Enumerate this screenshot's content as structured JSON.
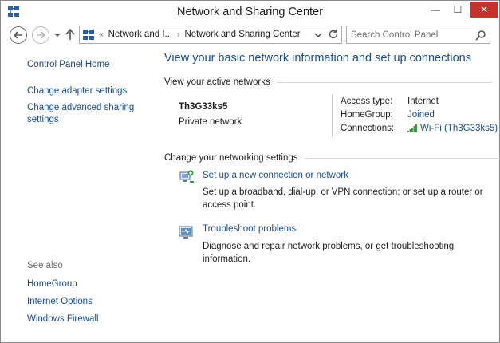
{
  "window": {
    "title": "Network and Sharing Center",
    "controls": {
      "minimize": "—",
      "maximize": "☐",
      "close": "✕"
    }
  },
  "address": {
    "breadcrumb_prefix": "«",
    "crumbs": [
      "Network and I...",
      "Network and Sharing Center"
    ],
    "crumb_separator": "›"
  },
  "search": {
    "placeholder": "Search Control Panel"
  },
  "sidebar": {
    "home": "Control Panel Home",
    "adapter": "Change adapter settings",
    "advanced": "Change advanced sharing settings",
    "see_also": "See also",
    "see_also_links": [
      "HomeGroup",
      "Internet Options",
      "Windows Firewall"
    ]
  },
  "main": {
    "heading": "View your basic network information and set up connections",
    "active_networks_label": "View your active networks",
    "network": {
      "name": "Th3G33ks5",
      "type": "Private network",
      "access_type_label": "Access type:",
      "access_type_value": "Internet",
      "homegroup_label": "HomeGroup:",
      "homegroup_value": "Joined",
      "connections_label": "Connections:",
      "connections_value": "Wi-Fi (Th3G33ks5)"
    },
    "change_settings_label": "Change your networking settings",
    "tasks": [
      {
        "link": "Set up a new connection or network",
        "description": "Set up a broadband, dial-up, or VPN connection; or set up a router or access point."
      },
      {
        "link": "Troubleshoot problems",
        "description": "Diagnose and repair network problems, or get troubleshooting information."
      }
    ]
  },
  "colors": {
    "link": "#1a4d93",
    "close_button": "#c7332b",
    "wifi_bars": "#3a9a3a"
  }
}
